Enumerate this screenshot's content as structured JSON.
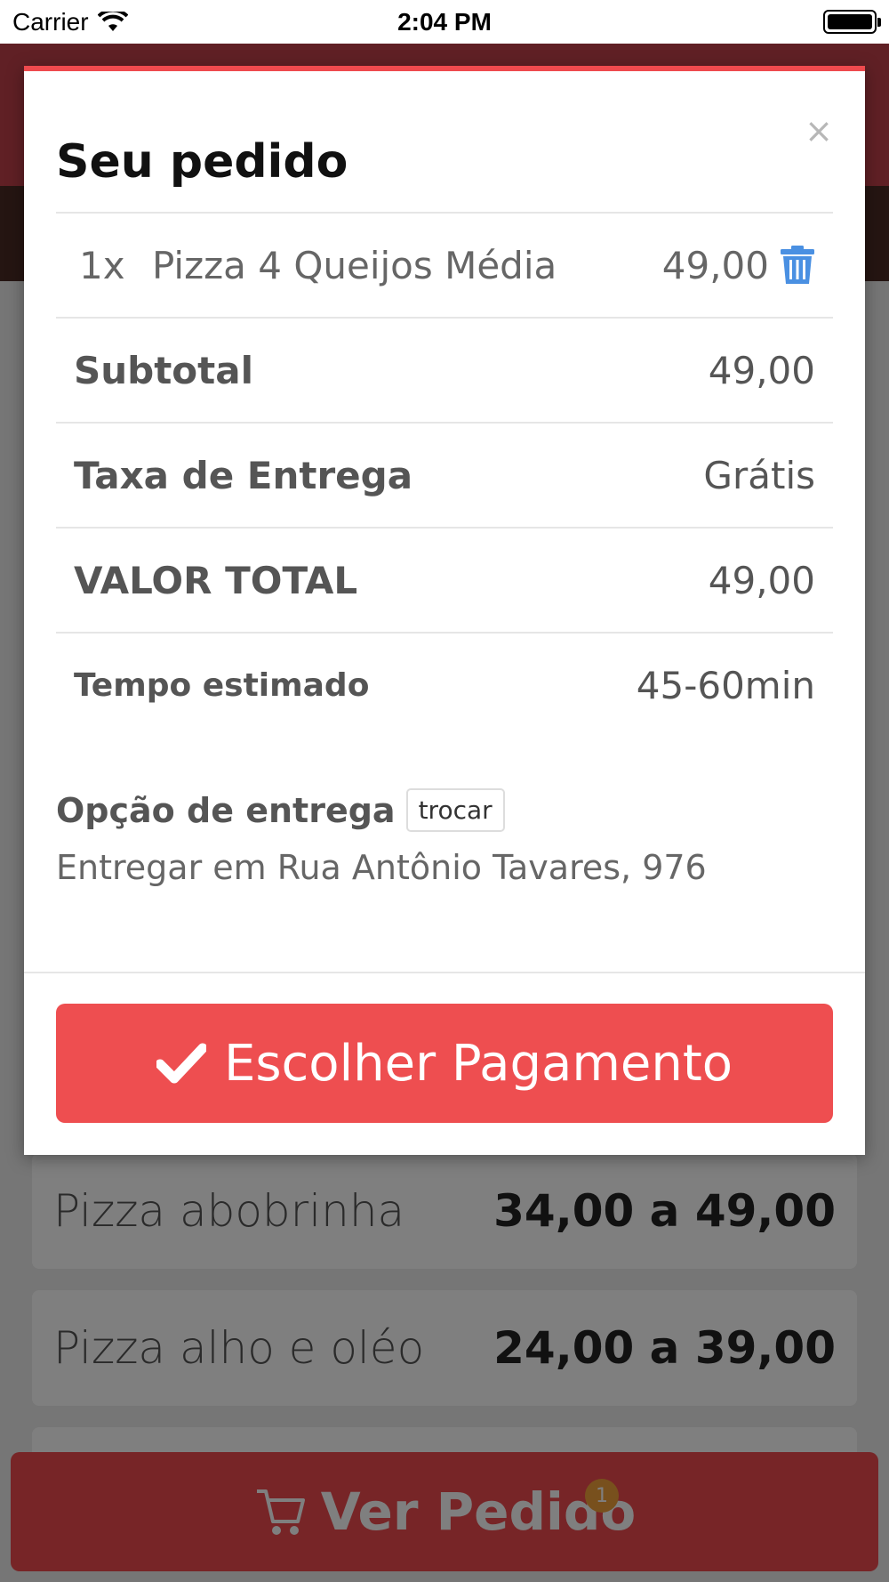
{
  "status_bar": {
    "carrier": "Carrier",
    "time": "2:04 PM"
  },
  "background": {
    "menu_items": [
      {
        "name": "Pizza abobrinha",
        "price": "34,00 a 49,00"
      },
      {
        "name": "Pizza alho e oléo",
        "price": "24,00 a 39,00"
      }
    ],
    "cart_button": {
      "label": "Ver Pedido",
      "badge": "1"
    }
  },
  "modal": {
    "title": "Seu pedido",
    "close": "×",
    "item": {
      "qty": "1x",
      "name": "Pizza 4 Queijos Média",
      "price": "49,00"
    },
    "subtotal": {
      "label": "Subtotal",
      "value": "49,00"
    },
    "taxa": {
      "label": "Taxa de Entrega",
      "value": "Grátis"
    },
    "total": {
      "label": "VALOR TOTAL",
      "value": "49,00"
    },
    "tempo": {
      "label": "Tempo estimado",
      "value": "45-60min"
    },
    "entrega": {
      "label": "Opção de entrega",
      "change": "trocar",
      "address": "Entregar em Rua Antônio Tavares, 976"
    },
    "pay_button": "Escolher Pagamento"
  },
  "colors": {
    "accent": "#ee4a4e",
    "trash_icon": "#4a90e2"
  }
}
